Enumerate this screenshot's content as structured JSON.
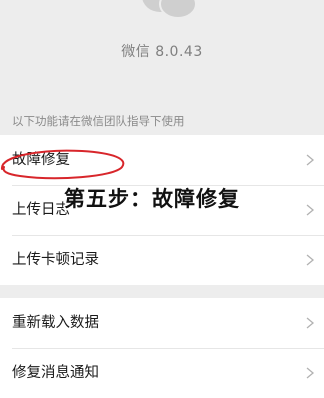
{
  "header": {
    "logo_icon": "wechat-logo-icon",
    "version_text": "微信 8.0.43"
  },
  "hint_text": "以下功能请在微信团队指导下使用",
  "list_group_1": [
    {
      "label": "故障修复",
      "icon": "chevron-right-icon"
    },
    {
      "label": "上传日志",
      "icon": "chevron-right-icon"
    },
    {
      "label": "上传卡顿记录",
      "icon": "chevron-right-icon"
    }
  ],
  "list_group_2": [
    {
      "label": "重新载入数据",
      "icon": "chevron-right-icon"
    },
    {
      "label": "修复消息通知",
      "icon": "chevron-right-icon"
    }
  ],
  "annotation": {
    "overlay_text": "第五步：故障修复",
    "circle_color": "#d8262b"
  },
  "colors": {
    "background": "#ededed",
    "card": "#ffffff",
    "secondary_text": "#7f7f7f",
    "chevron": "#b2b2b2"
  }
}
